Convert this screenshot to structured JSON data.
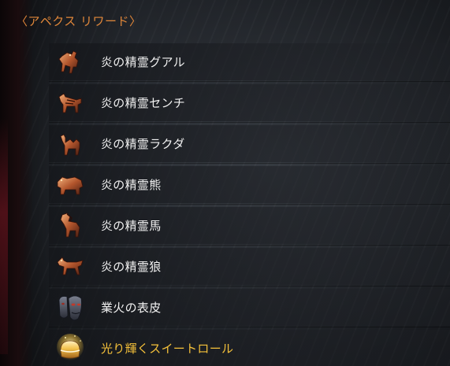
{
  "panel": {
    "title": "〈アペクス リワード〉"
  },
  "rewards": [
    {
      "label": "炎の精霊グアル",
      "icon": "fire-spirit-guar-icon"
    },
    {
      "label": "炎の精霊センチ",
      "icon": "fire-spirit-senche-icon"
    },
    {
      "label": "炎の精霊ラクダ",
      "icon": "fire-spirit-camel-icon"
    },
    {
      "label": "炎の精霊熊",
      "icon": "fire-spirit-bear-icon"
    },
    {
      "label": "炎の精霊馬",
      "icon": "fire-spirit-horse-icon"
    },
    {
      "label": "炎の精霊狼",
      "icon": "fire-spirit-wolf-icon"
    },
    {
      "label": "業火の表皮",
      "icon": "infernal-mask-icon"
    },
    {
      "label": "光り輝くスイートロール",
      "icon": "glowing-sweetroll-icon"
    }
  ],
  "colors": {
    "header": "#e0873a",
    "label": "#f1f1f1",
    "highlight_label": "#f5c13a"
  }
}
